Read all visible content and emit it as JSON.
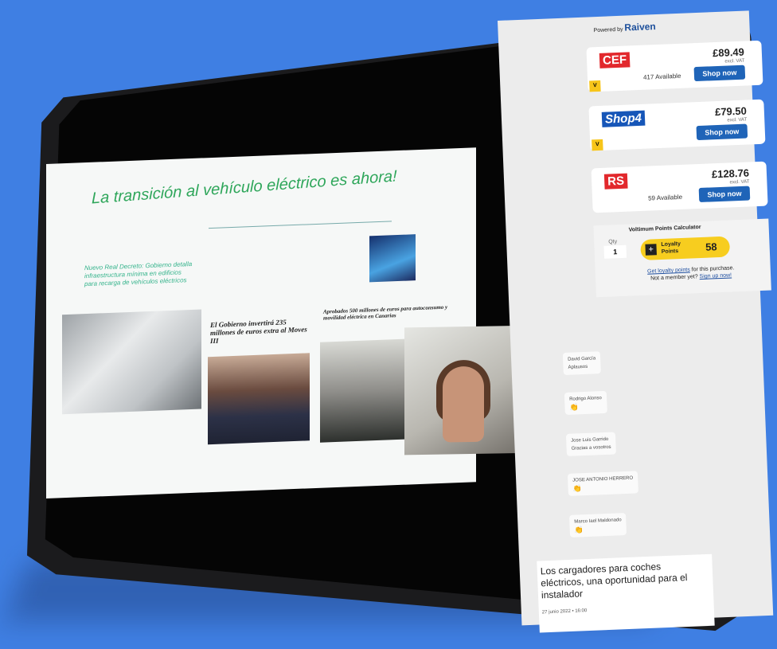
{
  "slide": {
    "title": "La transición al vehículo eléctrico es ahora!",
    "subtitle": "Nuevo Real Decreto: Gobierno detalla infraestructura mínima en edificios para recarga de vehículos eléctricos",
    "headline_1": "El Gobierno invertirá 235 millones de euros extra al Moves III",
    "headline_2": "Aprobados 500 millones de euros para autoconsumo y movilidad eléctrica en Canarias"
  },
  "sidebar": {
    "powered_by": "Powered by",
    "brand": "Raiven",
    "vat_note": "excl. VAT",
    "offers": [
      {
        "logo": "CEF",
        "price": "£89.49",
        "availability": "417 Available",
        "button": "Shop now",
        "color": "#e2282c"
      },
      {
        "logo": "Shop4",
        "price": "£79.50",
        "availability": "",
        "button": "Shop now",
        "color": "#1656b8"
      },
      {
        "logo": "RS",
        "price": "£128.76",
        "availability": "59 Available",
        "button": "Shop now",
        "color": "#e2282c"
      }
    ],
    "calculator": {
      "title": "Voltimum Points Calculator",
      "qty_label": "Qty",
      "qty": "1",
      "loyalty_label": "Loyalty Points",
      "loyalty_value": "58",
      "note_link": "Get loyalty points",
      "note_text": "for this purchase.",
      "member_text": "Not a member yet?",
      "member_link": "Sign up now!"
    },
    "chat": [
      {
        "name": "David García",
        "msg": "Aplausos"
      },
      {
        "name": "Rodrigo Alonso",
        "msg": "👏"
      },
      {
        "name": "Jose Luis Garrido",
        "msg": "Gracias a vosotros"
      },
      {
        "name": "JOSE ANTONIO HERRERO",
        "msg": "👏"
      },
      {
        "name": "Marco Iael Maldonado",
        "msg": "👏"
      }
    ],
    "article": {
      "title": "Los cargadores para coches eléctricos, una oportunidad para el instalador",
      "date": "27 junio 2022 • 16:00"
    }
  }
}
